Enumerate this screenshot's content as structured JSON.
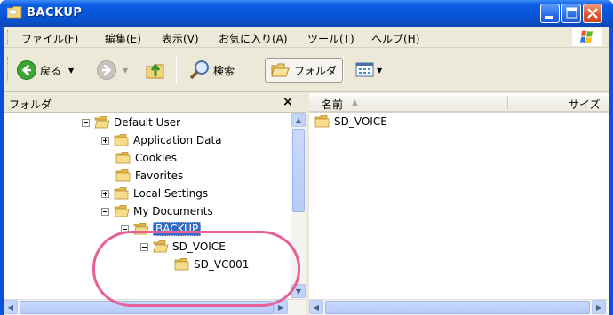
{
  "window": {
    "title": "BACKUP",
    "controls": [
      "minimize",
      "maximize",
      "close"
    ]
  },
  "menu": {
    "items": [
      "ファイル(F)",
      "編集(E)",
      "表示(V)",
      "お気に入り(A)",
      "ツール(T)",
      "ヘルプ(H)"
    ]
  },
  "toolbar": {
    "back_label": "戻る",
    "search_label": "検索",
    "folders_label": "フォルダ"
  },
  "folder_pane": {
    "title": "フォルダ",
    "close_label": "×",
    "tree": [
      {
        "label": "Default User",
        "depth": 0,
        "expander": "minus"
      },
      {
        "label": "Application Data",
        "depth": 1,
        "expander": "plus"
      },
      {
        "label": "Cookies",
        "depth": 1,
        "expander": "none"
      },
      {
        "label": "Favorites",
        "depth": 1,
        "expander": "none"
      },
      {
        "label": "Local Settings",
        "depth": 1,
        "expander": "plus"
      },
      {
        "label": "My Documents",
        "depth": 1,
        "expander": "minus"
      },
      {
        "label": "BACKUP",
        "depth": 2,
        "expander": "minus",
        "selected": true
      },
      {
        "label": "SD_VOICE",
        "depth": 3,
        "expander": "minus"
      },
      {
        "label": "SD_VC001",
        "depth": 4,
        "expander": "none"
      }
    ]
  },
  "file_list": {
    "columns": {
      "name": "名前",
      "size": "サイズ"
    },
    "items": [
      {
        "name": "SD_VOICE"
      }
    ]
  },
  "colors": {
    "titlebar": "#0a50d8",
    "selection": "#316ac5",
    "highlight_ring": "#e8609a",
    "folder": "#f3d27a"
  }
}
